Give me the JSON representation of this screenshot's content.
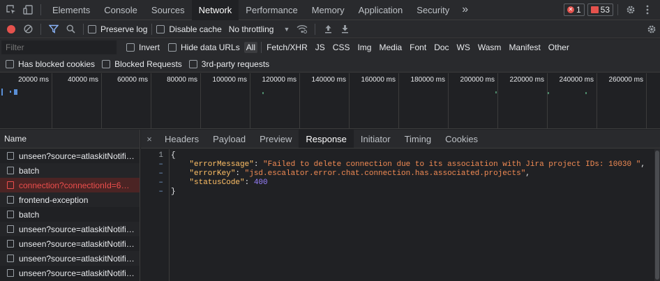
{
  "tabbar": {
    "tabs": [
      "Elements",
      "Console",
      "Sources",
      "Network",
      "Performance",
      "Memory",
      "Application",
      "Security"
    ],
    "active_tab": "Network",
    "more": "»",
    "errors_count": "1",
    "issues_count": "53"
  },
  "toolbar": {
    "preserve_log": "Preserve log",
    "disable_cache": "Disable cache",
    "throttling": "No throttling"
  },
  "filterbar": {
    "placeholder": "Filter",
    "invert": "Invert",
    "hide_data_urls": "Hide data URLs",
    "types": [
      "All",
      "Fetch/XHR",
      "JS",
      "CSS",
      "Img",
      "Media",
      "Font",
      "Doc",
      "WS",
      "Wasm",
      "Manifest",
      "Other"
    ],
    "active_type": "All",
    "has_blocked_cookies": "Has blocked cookies",
    "blocked_requests": "Blocked Requests",
    "third_party": "3rd-party requests"
  },
  "overview": {
    "ticks": [
      "20000 ms",
      "40000 ms",
      "60000 ms",
      "80000 ms",
      "100000 ms",
      "120000 ms",
      "140000 ms",
      "160000 ms",
      "180000 ms",
      "200000 ms",
      "220000 ms",
      "240000 ms",
      "260000 ms"
    ]
  },
  "requests": {
    "header": "Name",
    "rows": [
      {
        "name": "unseen?source=atlaskitNotifi…",
        "error": false
      },
      {
        "name": "batch",
        "error": false
      },
      {
        "name": "connection?connectionId=6…",
        "error": true
      },
      {
        "name": "frontend-exception",
        "error": false
      },
      {
        "name": "batch",
        "error": false
      },
      {
        "name": "unseen?source=atlaskitNotifi…",
        "error": false
      },
      {
        "name": "unseen?source=atlaskitNotifi…",
        "error": false
      },
      {
        "name": "unseen?source=atlaskitNotifi…",
        "error": false
      },
      {
        "name": "unseen?source=atlaskitNotifi…",
        "error": false
      }
    ]
  },
  "details": {
    "close": "×",
    "tabs": [
      "Headers",
      "Payload",
      "Preview",
      "Response",
      "Initiator",
      "Timing",
      "Cookies"
    ],
    "active_tab": "Response",
    "response": {
      "line1": "1",
      "open": "{",
      "close": "}",
      "key_errorMessage": "\"errorMessage\"",
      "val_errorMessage": "\"Failed to delete connection due to its association with Jira project IDs: 10030 \"",
      "key_errorKey": "\"errorKey\"",
      "val_errorKey": "\"jsd.escalator.error.chat.connection.has.associated.projects\"",
      "key_statusCode": "\"statusCode\"",
      "val_statusCode": "400"
    }
  },
  "colors": {
    "error_red": "#e5524d",
    "json_key": "#ffc066",
    "json_string": "#f28b54",
    "json_number": "#9980ff"
  }
}
